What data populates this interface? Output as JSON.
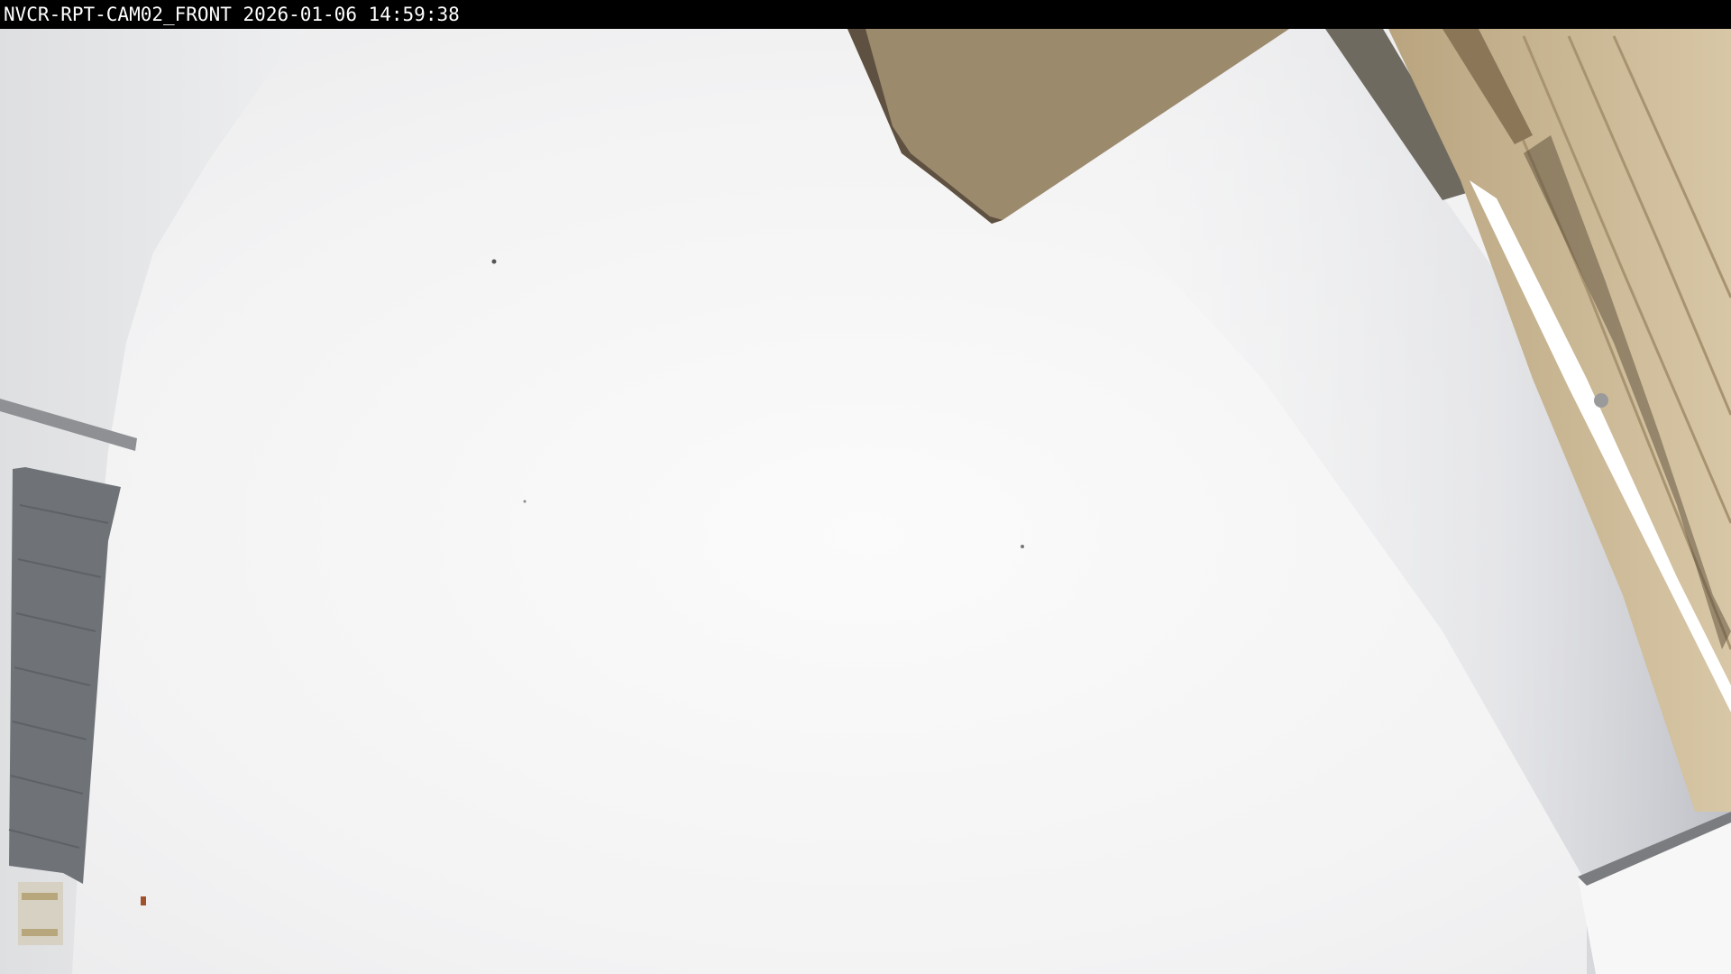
{
  "camera_overlay": {
    "camera_id": "NVCR-RPT-CAM02_FRONT",
    "timestamp": "2026-01-06 14:59:38"
  },
  "colors": {
    "osd_background": "#000000",
    "osd_text": "#ffffff",
    "snow": "#f3f3f4",
    "fog": "#e6e7e9",
    "roof_overhang": "#9c8a6d",
    "building_siding": "#c9b48f",
    "equipment_box": "#6f7377"
  }
}
